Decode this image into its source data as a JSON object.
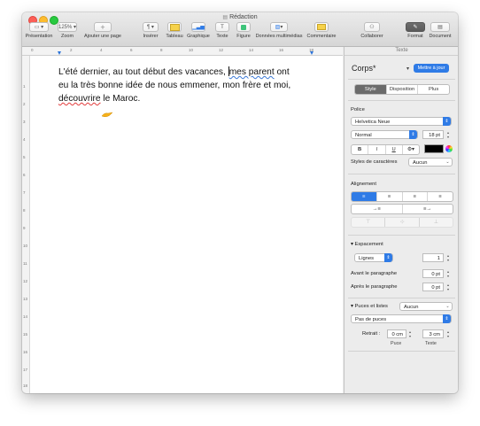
{
  "window": {
    "title": "Rédaction"
  },
  "toolbar": {
    "presentation": "Présentation",
    "zoom_value": "125%",
    "zoom": "Zoom",
    "add_page": "Ajouter une page",
    "insert": "Insérer",
    "table": "Tableau",
    "chart": "Graphique",
    "text": "Texte",
    "shape": "Figure",
    "media": "Données multimédias",
    "comment": "Commentaire",
    "collaborate": "Collaborer",
    "format": "Format",
    "document": "Document"
  },
  "ruler": {
    "numbers": [
      "0",
      "2",
      "4",
      "6",
      "8",
      "10",
      "12",
      "14",
      "16",
      "18"
    ],
    "vnumbers": [
      "1",
      "2",
      "3",
      "4",
      "5",
      "6",
      "7",
      "8",
      "9",
      "10",
      "11",
      "12",
      "13",
      "14",
      "15",
      "16",
      "17",
      "18"
    ]
  },
  "document": {
    "line1a": "L'été dernier, au tout début des vacances, ",
    "line1err": "mes parent",
    "line1b": " ont",
    "line2": "eu la très bonne idée de nous emmener, mon frère et moi,",
    "line3err": "découvrire",
    "line3b": " le Maroc."
  },
  "sidebar": {
    "header": "Texte",
    "style_name": "Corps*",
    "update_button": "Mettre à jour",
    "tabs": [
      "Style",
      "Disposition",
      "Plus"
    ],
    "font_section": "Police",
    "font_name": "Helvetica Neue",
    "font_style": "Normal",
    "font_size": "18 pt",
    "bold": "B",
    "italic": "I",
    "underline": "U",
    "text_color": "#000000",
    "char_styles_label": "Styles de caractères",
    "char_styles_value": "Aucun",
    "alignment_section": "Alignement",
    "spacing_section": "Espacement",
    "spacing_type": "Lignes",
    "spacing_value": "1",
    "before_label": "Avant le paragraphe",
    "before_value": "0 pt",
    "after_label": "Après le paragraphe",
    "after_value": "0 pt",
    "bullets_section": "Puces et listes",
    "bullets_value": "Aucun",
    "bullets_type": "Pas de puces",
    "indent_label": "Retrait :",
    "bullet_indent": "0 cm",
    "text_indent": "3 cm",
    "bullet_label": "Puce",
    "text_label": "Texte"
  },
  "colors": {
    "accent": "#2f7be6",
    "spell_error": "#e23b3b",
    "grammar": "#3a78d6"
  }
}
